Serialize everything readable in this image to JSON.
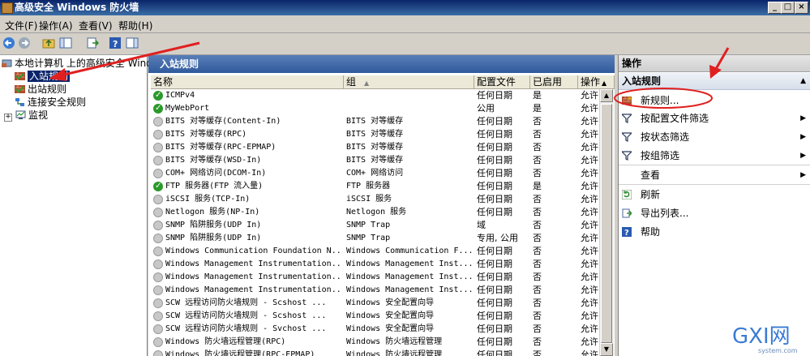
{
  "window": {
    "title": "高级安全 Windows 防火墙",
    "minimize": "_",
    "restore": "□",
    "close": "×"
  },
  "menu": [
    "文件(F)",
    "操作(A)",
    "查看(V)",
    "帮助(H)"
  ],
  "tree": {
    "root": "本地计算机 上的高级安全 Windows",
    "items": [
      "入站规则",
      "出站规则",
      "连接安全规则",
      "监视"
    ],
    "expander": "+"
  },
  "center": {
    "header": "入站规则",
    "columns": [
      "名称",
      "组",
      "配置文件",
      "已启用",
      "操作"
    ],
    "sort_indicator": "▲",
    "rows": [
      {
        "enabled_icon": "on",
        "name": "ICMPv4",
        "group": "",
        "profile": "任何日期",
        "enabled": "是",
        "action": "允许"
      },
      {
        "enabled_icon": "on",
        "name": "MyWebPort",
        "group": "",
        "profile": "公用",
        "enabled": "是",
        "action": "允许"
      },
      {
        "enabled_icon": "off",
        "name": "BITS 对等缓存(Content-In)",
        "group": "BITS 对等缓存",
        "profile": "任何日期",
        "enabled": "否",
        "action": "允许"
      },
      {
        "enabled_icon": "off",
        "name": "BITS 对等缓存(RPC)",
        "group": "BITS 对等缓存",
        "profile": "任何日期",
        "enabled": "否",
        "action": "允许"
      },
      {
        "enabled_icon": "off",
        "name": "BITS 对等缓存(RPC-EPMAP)",
        "group": "BITS 对等缓存",
        "profile": "任何日期",
        "enabled": "否",
        "action": "允许"
      },
      {
        "enabled_icon": "off",
        "name": "BITS 对等缓存(WSD-In)",
        "group": "BITS 对等缓存",
        "profile": "任何日期",
        "enabled": "否",
        "action": "允许"
      },
      {
        "enabled_icon": "off",
        "name": "COM+ 网络访问(DCOM-In)",
        "group": "COM+ 网络访问",
        "profile": "任何日期",
        "enabled": "否",
        "action": "允许"
      },
      {
        "enabled_icon": "on",
        "name": "FTP 服务器(FTP 流入量)",
        "group": "FTP 服务器",
        "profile": "任何日期",
        "enabled": "是",
        "action": "允许"
      },
      {
        "enabled_icon": "off",
        "name": "iSCSI 服务(TCP-In)",
        "group": "iSCSI 服务",
        "profile": "任何日期",
        "enabled": "否",
        "action": "允许"
      },
      {
        "enabled_icon": "off",
        "name": "Netlogon 服务(NP-In)",
        "group": "Netlogon 服务",
        "profile": "任何日期",
        "enabled": "否",
        "action": "允许"
      },
      {
        "enabled_icon": "off",
        "name": "SNMP 陷阱服务(UDP In)",
        "group": "SNMP Trap",
        "profile": "域",
        "enabled": "否",
        "action": "允许"
      },
      {
        "enabled_icon": "off",
        "name": "SNMP 陷阱服务(UDP In)",
        "group": "SNMP Trap",
        "profile": "专用, 公用",
        "enabled": "否",
        "action": "允许"
      },
      {
        "enabled_icon": "off",
        "name": "Windows Communication Foundation N...",
        "group": "Windows Communication F...",
        "profile": "任何日期",
        "enabled": "否",
        "action": "允许"
      },
      {
        "enabled_icon": "off",
        "name": "Windows Management Instrumentation...",
        "group": "Windows Management Inst...",
        "profile": "任何日期",
        "enabled": "否",
        "action": "允许"
      },
      {
        "enabled_icon": "off",
        "name": "Windows Management Instrumentation...",
        "group": "Windows Management Inst...",
        "profile": "任何日期",
        "enabled": "否",
        "action": "允许"
      },
      {
        "enabled_icon": "off",
        "name": "Windows Management Instrumentation...",
        "group": "Windows Management Inst...",
        "profile": "任何日期",
        "enabled": "否",
        "action": "允许"
      },
      {
        "enabled_icon": "off",
        "name": "SCW 远程访问防火墙规则 - Scshost ...",
        "group": "Windows 安全配置向导",
        "profile": "任何日期",
        "enabled": "否",
        "action": "允许"
      },
      {
        "enabled_icon": "off",
        "name": "SCW 远程访问防火墙规则 - Scshost ...",
        "group": "Windows 安全配置向导",
        "profile": "任何日期",
        "enabled": "否",
        "action": "允许"
      },
      {
        "enabled_icon": "off",
        "name": "SCW 远程访问防火墙规则 - Svchost ...",
        "group": "Windows 安全配置向导",
        "profile": "任何日期",
        "enabled": "否",
        "action": "允许"
      },
      {
        "enabled_icon": "off",
        "name": "Windows 防火墙远程管理(RPC)",
        "group": "Windows 防火墙远程管理",
        "profile": "任何日期",
        "enabled": "否",
        "action": "允许"
      },
      {
        "enabled_icon": "off",
        "name": "Windows 防火墙远程管理(RPC-EPMAP)",
        "group": "Windows 防火墙远程管理",
        "profile": "任何日期",
        "enabled": "否",
        "action": "允许"
      }
    ]
  },
  "actions": {
    "header": "操作",
    "subheader": "入站规则",
    "items": [
      {
        "label": "新规则...",
        "icon": "new-rule-icon",
        "submenu": false
      },
      {
        "label": "按配置文件筛选",
        "icon": "filter-icon",
        "submenu": true
      },
      {
        "label": "按状态筛选",
        "icon": "filter-icon",
        "submenu": true
      },
      {
        "label": "按组筛选",
        "icon": "filter-icon",
        "submenu": true
      },
      {
        "label": "查看",
        "icon": "",
        "submenu": true
      },
      {
        "label": "刷新",
        "icon": "refresh-icon",
        "submenu": false
      },
      {
        "label": "导出列表...",
        "icon": "export-icon",
        "submenu": false
      },
      {
        "label": "帮助",
        "icon": "help-icon",
        "submenu": false
      }
    ]
  },
  "watermark": {
    "brand": "GXI网",
    "domain": "system.com"
  },
  "colors": {
    "enabled": "#2a9a2a",
    "annotation": "#e02020",
    "header_blue": "#2f5a9c"
  }
}
